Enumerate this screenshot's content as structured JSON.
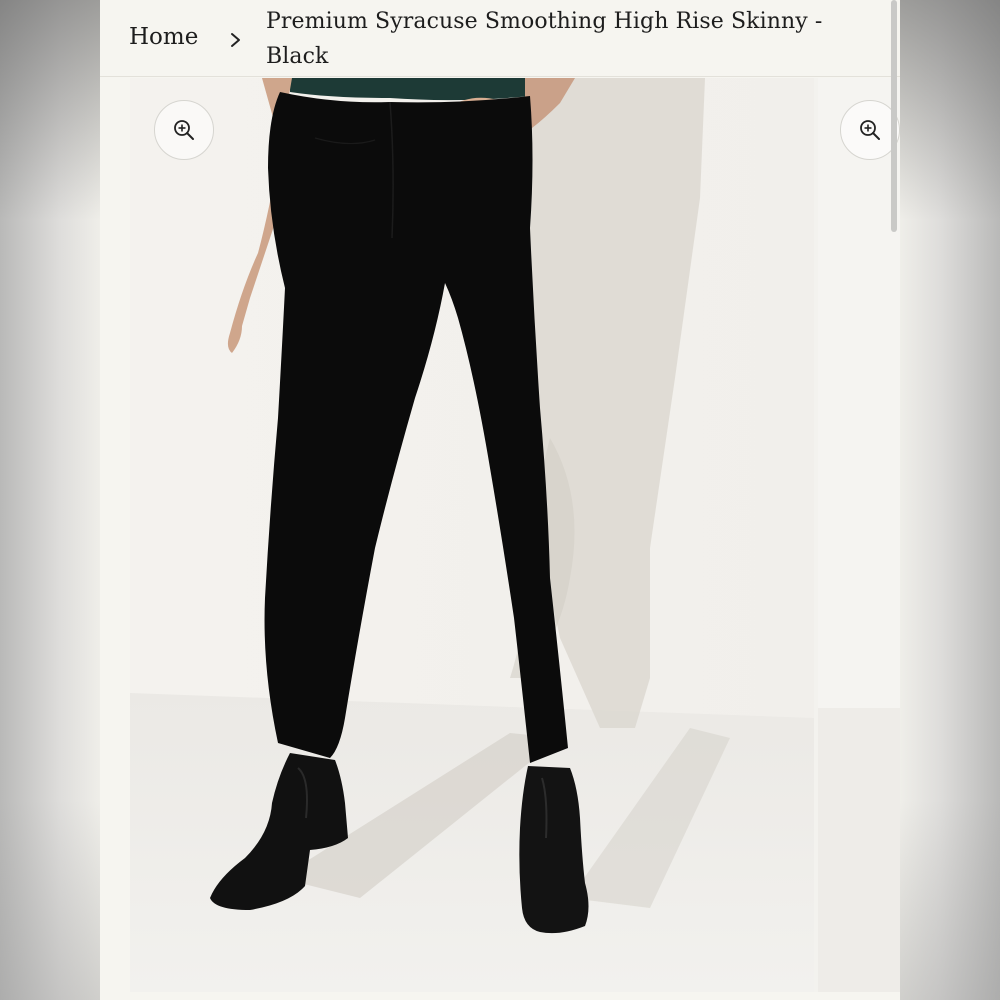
{
  "breadcrumb": {
    "home_label": "Home",
    "separator_icon": "chevron-right-icon",
    "current_title": "Premium Syracuse Smoothing High Rise Skinny - Black"
  },
  "gallery": {
    "zoom_icon": "zoom-in-icon",
    "slide_count": 2,
    "active_slide": 1
  },
  "colors": {
    "background": "#f6f5f0",
    "text": "#1d1d1d",
    "dot_active": "#111111",
    "dot_inactive": "#9a9a9a"
  }
}
